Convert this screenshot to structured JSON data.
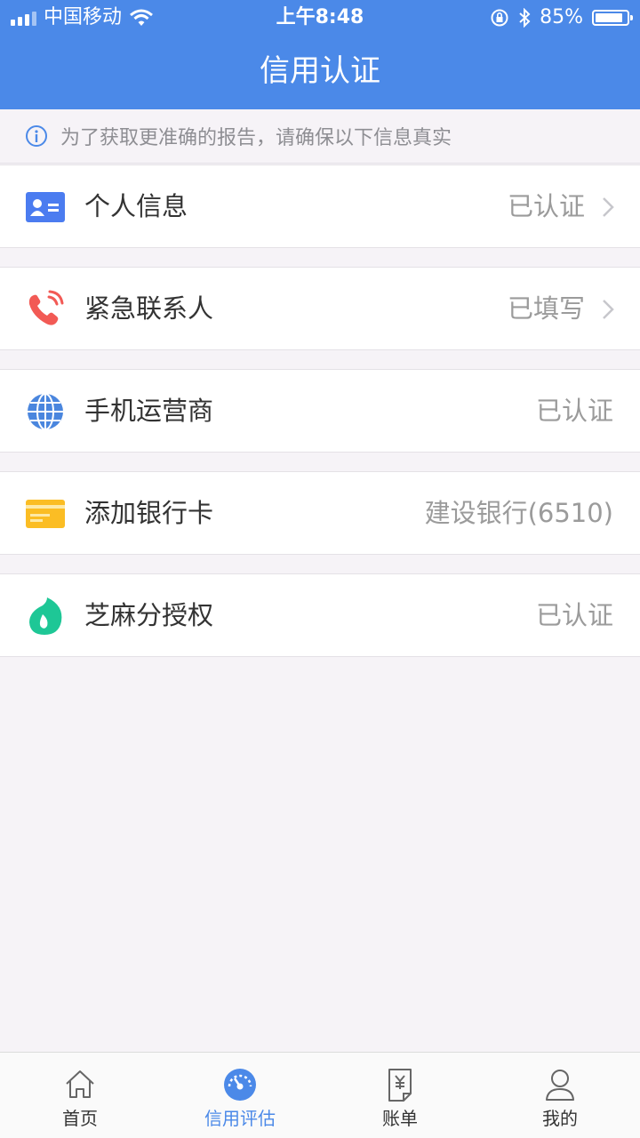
{
  "status_bar": {
    "carrier": "中国移动",
    "time": "上午8:48",
    "battery": "85%"
  },
  "header": {
    "title": "信用认证"
  },
  "notice": {
    "text": "为了获取更准确的报告，请确保以下信息真实"
  },
  "items": [
    {
      "label": "个人信息",
      "value": "已认证",
      "chevron": true,
      "icon": "id-card-icon",
      "color": "#4b7cf0"
    },
    {
      "label": "紧急联系人",
      "value": "已填写",
      "chevron": true,
      "icon": "phone-icon",
      "color": "#f25a55"
    },
    {
      "label": "手机运营商",
      "value": "已认证",
      "chevron": false,
      "icon": "globe-icon",
      "color": "#4a86de"
    },
    {
      "label": "添加银行卡",
      "value": "建设银行(6510)",
      "chevron": false,
      "icon": "bank-card-icon",
      "color": "#fbbd24"
    },
    {
      "label": "芝麻分授权",
      "value": "已认证",
      "chevron": false,
      "icon": "sesame-icon",
      "color": "#1ec796"
    }
  ],
  "tabs": [
    {
      "label": "首页",
      "icon": "home-icon",
      "active": false
    },
    {
      "label": "信用评估",
      "icon": "gauge-icon",
      "active": true
    },
    {
      "label": "账单",
      "icon": "bill-icon",
      "active": false
    },
    {
      "label": "我的",
      "icon": "user-icon",
      "active": false
    }
  ],
  "colors": {
    "primary": "#4b89e8",
    "background": "#f6f3f7"
  }
}
